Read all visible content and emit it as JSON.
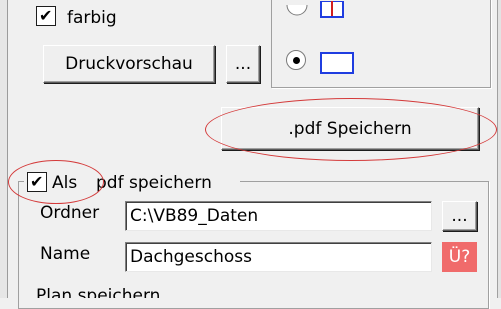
{
  "print": {
    "farbig_label": "farbig",
    "farbig_checked": true,
    "preview_button": "Druckvorschau",
    "preview_ellipsis": "..."
  },
  "orientation": {
    "radio_selected": "landscape"
  },
  "pdf_save_button": ".pdf Speichern",
  "pdf_group": {
    "checkbox_label_part1": "Als",
    "checkbox_label_part2": "pdf speichern",
    "checked": true,
    "folder_label": "Ordner",
    "folder_value": "C:\\VB89_Daten",
    "folder_browse": "...",
    "name_label": "Name",
    "name_value": "Dachgeschoss",
    "overwrite_badge": "Ü?"
  },
  "bottom_section_label": "Plan speichern",
  "colors": {
    "highlight_ellipse": "#d43a3a",
    "badge_bg": "#f06b6b",
    "shape_outline_blue": "#1f3de0",
    "shape_mark_red": "#d21e1e"
  }
}
